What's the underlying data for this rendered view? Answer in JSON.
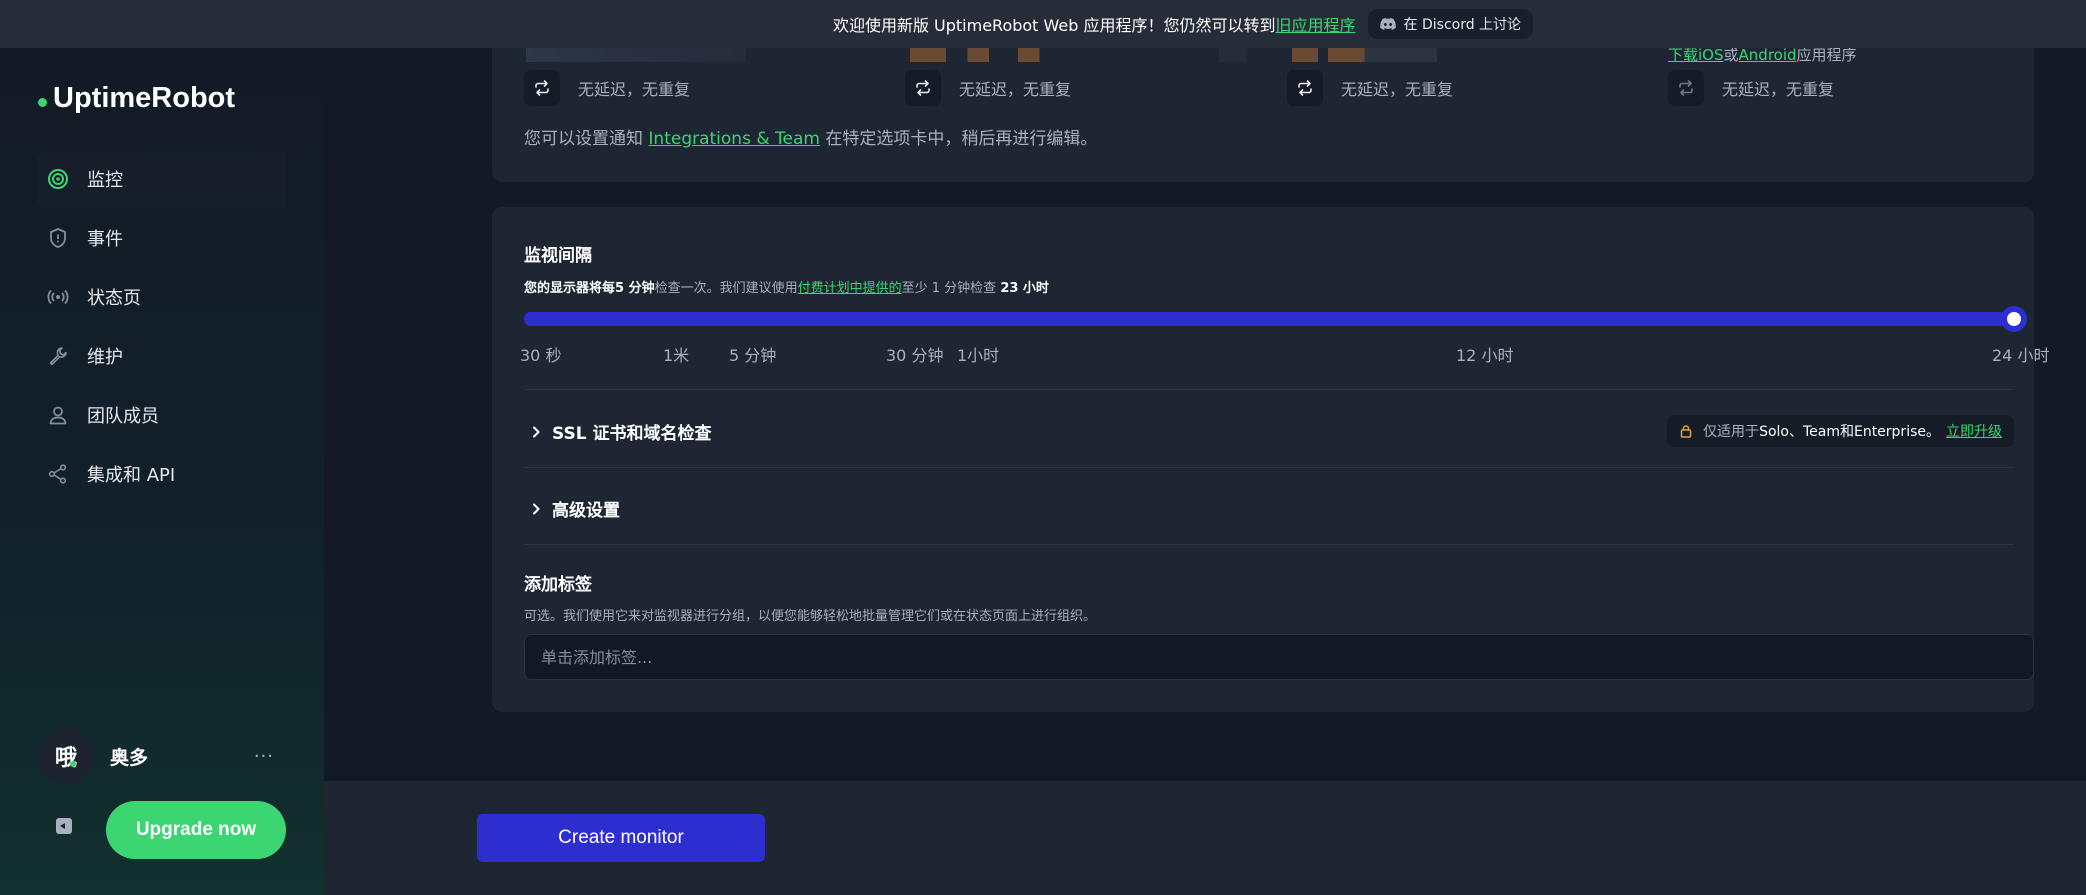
{
  "banner": {
    "text": "欢迎使用新版 UptimeRobot Web 应用程序！您仍然可以转到",
    "link": "旧应用程序",
    "discord_label": "在 Discord 上讨论"
  },
  "sidebar": {
    "logo": "UptimeRobot",
    "items": [
      {
        "label": "监控",
        "icon": "target-icon",
        "active": true
      },
      {
        "label": "事件",
        "icon": "shield-icon",
        "active": false
      },
      {
        "label": "状态页",
        "icon": "broadcast-icon",
        "active": false
      },
      {
        "label": "维护",
        "icon": "wrench-icon",
        "active": false
      },
      {
        "label": "团队成员",
        "icon": "user-icon",
        "active": false
      },
      {
        "label": "集成和 API",
        "icon": "share-nodes-icon",
        "active": false
      }
    ],
    "user": {
      "avatar_text": "哦",
      "name": "奥多",
      "more": "···"
    },
    "upgrade_label": "Upgrade now"
  },
  "notifications": {
    "columns": [
      {
        "label": "无延迟，无重复"
      },
      {
        "label": "无延迟，无重复"
      },
      {
        "label": "无延迟，无重复"
      },
      {
        "label": "无延迟，无重复"
      }
    ],
    "download_prefix": "下载",
    "download_ios": "iOS",
    "download_or": "或",
    "download_android": "Android",
    "download_suffix": "应用程序",
    "notify_prefix": "您可以设置通知",
    "notify_link": "Integrations & Team",
    "notify_suffix": "在特定选项卡中，稍后再进行编辑。"
  },
  "interval": {
    "title": "监视间隔",
    "desc_1": "您的显示器将每",
    "desc_value": "5 分钟",
    "desc_2": "检查一次。我们建议使用",
    "desc_link": "付费计划中提供的",
    "desc_3": "至少 1 分钟检查",
    "desc_value2": "23 小时",
    "slider_value_fraction": 1.0,
    "ticks": [
      "30 秒",
      "1米",
      "5 分钟",
      "30 分钟",
      "1小时",
      "12 小时",
      "24 小时"
    ]
  },
  "ssl": {
    "title": "SSL 证书和域名检查",
    "badge_prefix": "仅适用于",
    "badge_plans": "Solo、Team和Enterprise。",
    "badge_link": "立即升级"
  },
  "advanced": {
    "title": "高级设置"
  },
  "tags": {
    "title": "添加标签",
    "desc": "可选。我们使用它来对监视器进行分组，以便您能够轻松地批量管理它们或在状态页面上进行组织。",
    "placeholder": "单击添加标签..."
  },
  "create_label": "Create monitor",
  "colors": {
    "accent_green": "#3bd671",
    "primary_blue": "#2d2ecf"
  }
}
